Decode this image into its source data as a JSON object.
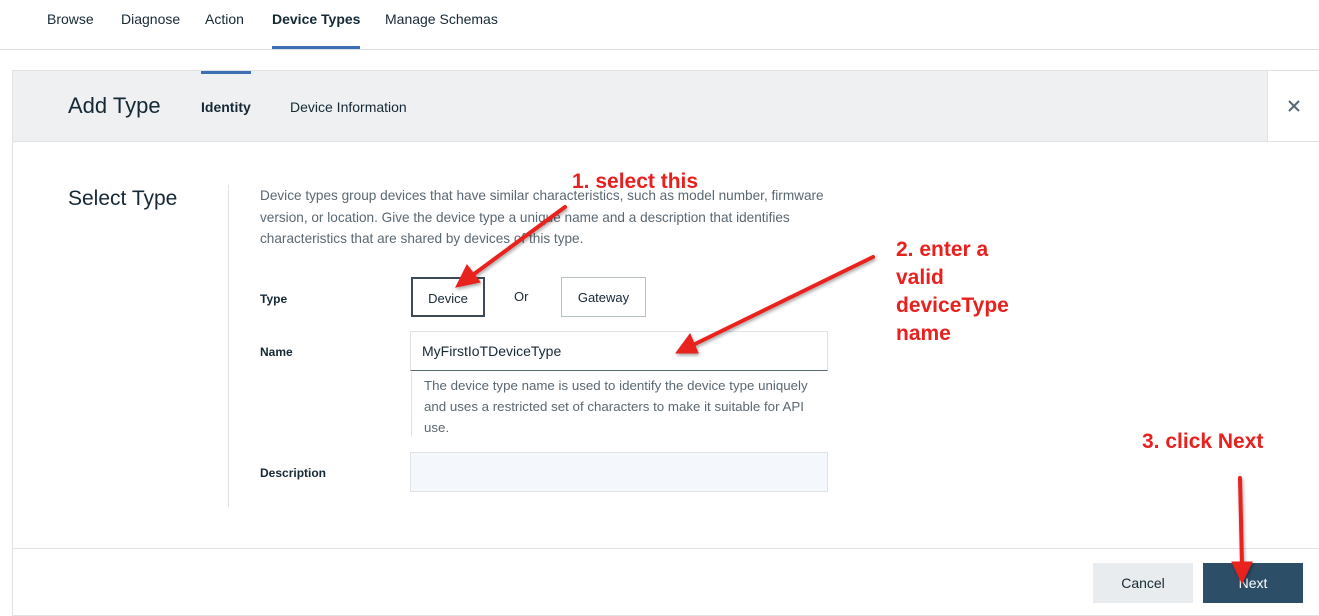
{
  "topnav": {
    "tabs": [
      {
        "label": "Browse",
        "active": false
      },
      {
        "label": "Diagnose",
        "active": false
      },
      {
        "label": "Action",
        "active": false
      },
      {
        "label": "Device Types",
        "active": true
      },
      {
        "label": "Manage Schemas",
        "active": false
      }
    ]
  },
  "panel": {
    "title": "Add Type",
    "tabs": [
      {
        "label": "Identity",
        "active": true
      },
      {
        "label": "Device Information",
        "active": false
      }
    ],
    "close_icon": "close-icon"
  },
  "form": {
    "section_title": "Select Type",
    "description": "Device types group devices that have similar characteristics, such as model number, firmware version, or location. Give the device type a unique name and a description that identifies characteristics that are shared by devices of this type.",
    "type_label": "Type",
    "type_options": {
      "device": "Device",
      "or": "Or",
      "gateway": "Gateway",
      "selected": "Device"
    },
    "name_label": "Name",
    "name_value": "MyFirstIoTDeviceType",
    "name_helper": "The device type name is used to identify the device type uniquely and uses a restricted set of characters to make it suitable for API use.",
    "description_label": "Description",
    "description_value": ""
  },
  "footer": {
    "cancel_label": "Cancel",
    "next_label": "Next"
  },
  "annotations": {
    "step1": "1. select this",
    "step2_lines": [
      "2. enter a",
      "valid",
      "deviceType",
      "name"
    ],
    "step3": "3. click Next",
    "color": "#e8201e"
  },
  "colors": {
    "accent": "#3d70b2",
    "primary_button": "#2d4e67",
    "header_bg": "#eef0f2"
  }
}
